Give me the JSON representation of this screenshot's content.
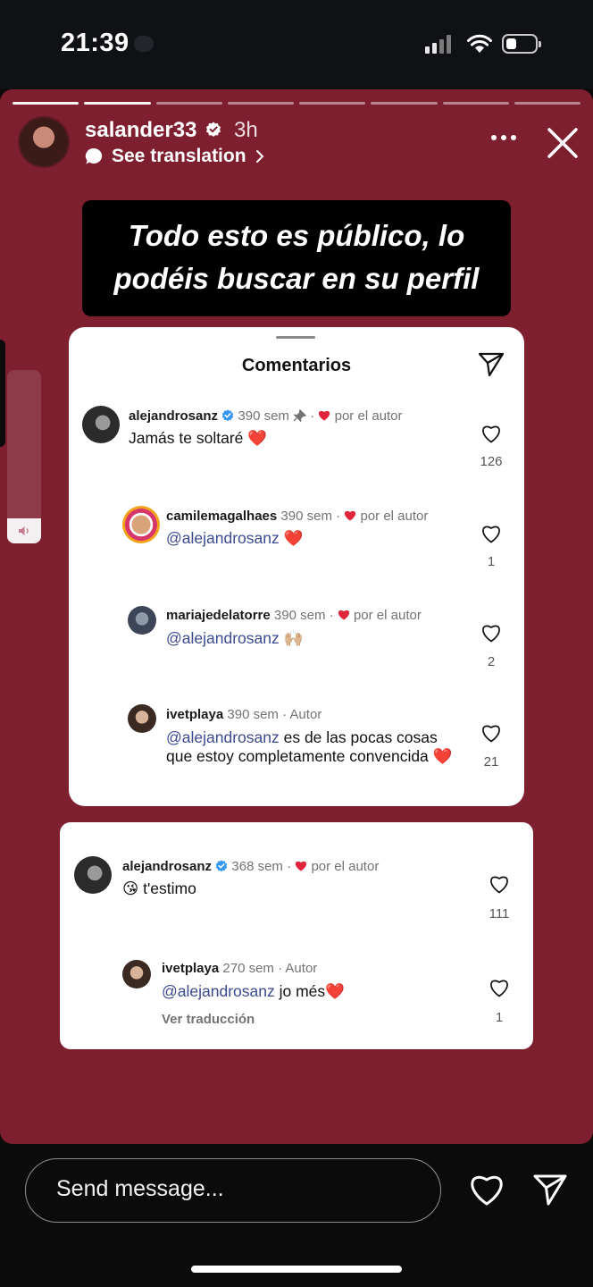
{
  "status_bar": {
    "time": "21:39"
  },
  "story": {
    "progress_segments": 8,
    "progress_done": 2,
    "username": "salander33",
    "time_ago": "3h",
    "see_translation": "See translation",
    "caption": "Todo esto es público, lo podéis buscar en su perfil"
  },
  "comments_card": {
    "title": "Comentarios",
    "comments": [
      {
        "user": "alejandrosanz",
        "meta_time": "390 sem",
        "meta_suffix": "por el autor",
        "text": "Jamás te soltaré ❤️",
        "likes": "126"
      },
      {
        "user": "camilemagalhaes",
        "meta_time": "390 sem ·",
        "meta_suffix": "por el autor",
        "mention": "@alejandrosanz",
        "text": " ❤️",
        "likes": "1"
      },
      {
        "user": "mariajedelatorre",
        "meta_time": "390 sem ·",
        "meta_suffix": "por el autor",
        "mention": "@alejandrosanz",
        "text": " 🙌🏼",
        "likes": "2"
      },
      {
        "user": "ivetplaya",
        "meta_time": "390 sem · Autor",
        "mention": "@alejandrosanz",
        "text": " es de las pocas cosas que estoy completamente convencida ❤️",
        "likes": "21"
      }
    ]
  },
  "comments_card_2": {
    "comments": [
      {
        "user": "alejandrosanz",
        "meta_time": "368 sem ·",
        "meta_suffix": "por el autor",
        "text": "😘 t'estimo",
        "likes": "111"
      },
      {
        "user": "ivetplaya",
        "meta_time": "270 sem · Autor",
        "mention": "@alejandrosanz",
        "text": " jo més❤️",
        "translate": "Ver traducción",
        "likes": "1"
      }
    ]
  },
  "bottom_bar": {
    "placeholder": "Send message..."
  },
  "colors": {
    "story_bg": "#7e1f30",
    "mention": "#3b4a8f",
    "heart_red": "#e0243b"
  }
}
